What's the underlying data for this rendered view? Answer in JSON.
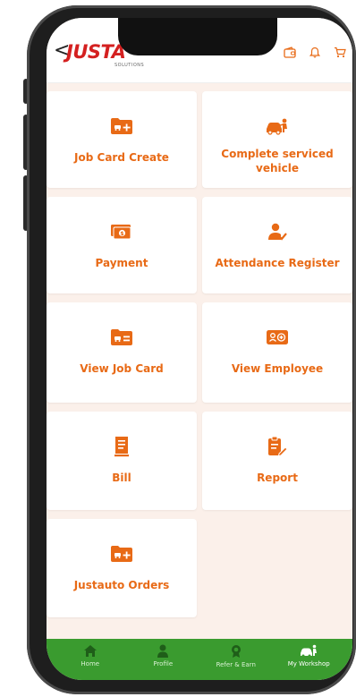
{
  "header": {
    "back_symbol": "<",
    "logo_text": "JUSTA",
    "logo_sub": "SOLUTIONS"
  },
  "menu": {
    "job_card_create": "Job Card Create",
    "complete_serviced": "Complete serviced vehicle",
    "payment": "Payment",
    "attendance_register": "Attendance Register",
    "view_job_card": "View Job Card",
    "view_employee": "View Employee",
    "bill": "Bill",
    "report": "Report",
    "justauto_orders": "Justauto Orders"
  },
  "tabs": {
    "home": "Home",
    "profile": "Profile",
    "refer": "Refer & Earn",
    "workshop": "My Workshop"
  },
  "colors": {
    "accent": "#e86a16",
    "tabbar": "#3a9b2f",
    "background": "#fbf0ea",
    "logo": "#d42020"
  }
}
